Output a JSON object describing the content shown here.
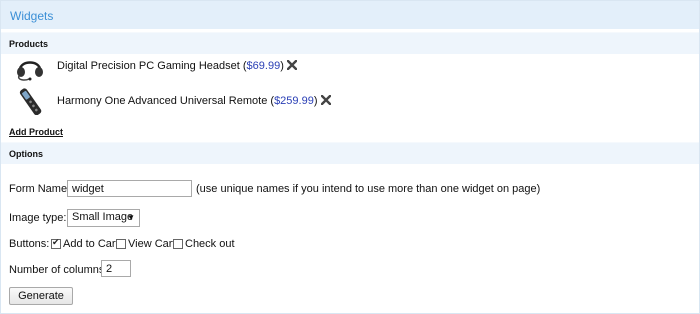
{
  "title": "Widgets",
  "products_section": {
    "label": "Products",
    "items": [
      {
        "name": "Digital Precision PC Gaming Headset",
        "price": "$69.99",
        "icon": "headset-icon"
      },
      {
        "name": "Harmony One Advanced Universal Remote",
        "price": "$259.99",
        "icon": "remote-icon"
      }
    ],
    "add_label": "Add Product",
    "remove_icon": "close-icon"
  },
  "options_section": {
    "label": "Options",
    "form_name": {
      "label": "Form Name:",
      "value": "widget",
      "hint": "(use unique names if you intend to use more than one widget on page)"
    },
    "image_type": {
      "label": "Image type:",
      "selected": "Small Image"
    },
    "buttons": {
      "label": "Buttons:",
      "options": [
        {
          "label": "Add to Cart",
          "checked": true
        },
        {
          "label": "View Cart",
          "checked": false
        },
        {
          "label": "Check out",
          "checked": false
        }
      ]
    },
    "columns": {
      "label": "Number of columns:",
      "value": "2"
    },
    "generate_label": "Generate"
  },
  "colors": {
    "accent": "#3b8fd6",
    "header_bg": "#e3effa",
    "section_bg": "#eef5fc",
    "price": "#2a3fb5"
  }
}
